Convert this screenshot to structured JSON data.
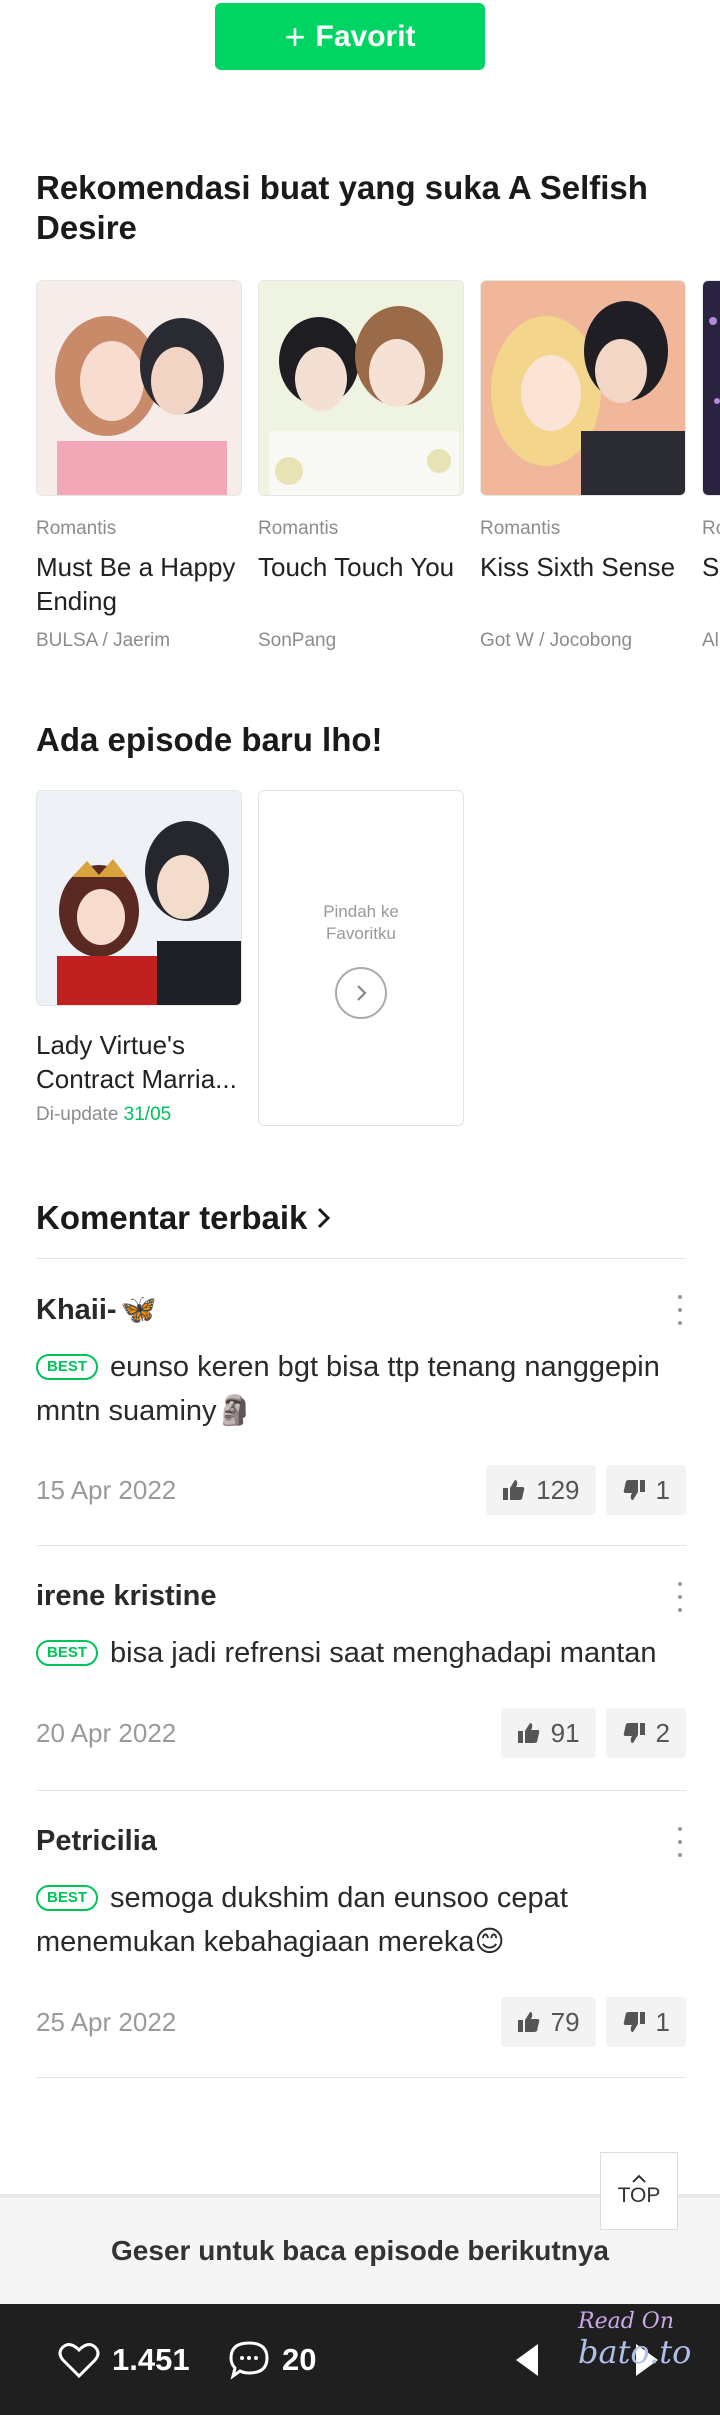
{
  "favorite_button": {
    "label": "Favorit"
  },
  "recommendations": {
    "title": "Rekomendasi buat yang suka A Selfish Desire",
    "items": [
      {
        "genre": "Romantis",
        "title": "Must Be a Happy Ending",
        "author": "BULSA / Jaerim"
      },
      {
        "genre": "Romantis",
        "title": "Touch Touch You",
        "author": "SonPang"
      },
      {
        "genre": "Romantis",
        "title": "Kiss Sixth Sense",
        "author": "Got W / Jocobong"
      },
      {
        "genre": "Ro",
        "title": "Sl",
        "author": "Al"
      }
    ]
  },
  "new_episodes": {
    "title": "Ada episode baru lho!",
    "items": [
      {
        "title": "Lady Virtue's Contract Marria...",
        "updated_label": "Di-update",
        "updated_date": "31/05"
      }
    ],
    "go_favorites": {
      "line1": "Pindah ke",
      "line2": "Favoritku"
    }
  },
  "comments": {
    "title": "Komentar terbaik",
    "best_badge": "BEST",
    "items": [
      {
        "user": "Khaii-",
        "user_emoji": "🦋",
        "text": "eunso keren bgt bisa ttp tenang nanggepin mntn suaminy",
        "text_emoji": "🗿",
        "date": "15 Apr 2022",
        "likes": "129",
        "dislikes": "1"
      },
      {
        "user": "irene kristine",
        "user_emoji": "",
        "text": "bisa jadi refrensi saat menghadapi mantan",
        "text_emoji": "",
        "date": "20 Apr 2022",
        "likes": "91",
        "dislikes": "2"
      },
      {
        "user": "Petricilia",
        "user_emoji": "",
        "text": "semoga dukshim dan eunsoo cepat menemukan kebahagiaan mereka",
        "text_emoji": "😊",
        "date": "25 Apr 2022",
        "likes": "79",
        "dislikes": "1"
      }
    ]
  },
  "top_button": {
    "label": "TOP"
  },
  "swipe_hint": "Geser untuk baca episode berikutnya",
  "bottom_bar": {
    "likes": "1.451",
    "comments": "20"
  },
  "watermark": {
    "line1": "Read On",
    "line2": "bato.to"
  },
  "colors": {
    "accent": "#00d564",
    "best": "#00c35a",
    "bar": "#1f1f1f"
  }
}
